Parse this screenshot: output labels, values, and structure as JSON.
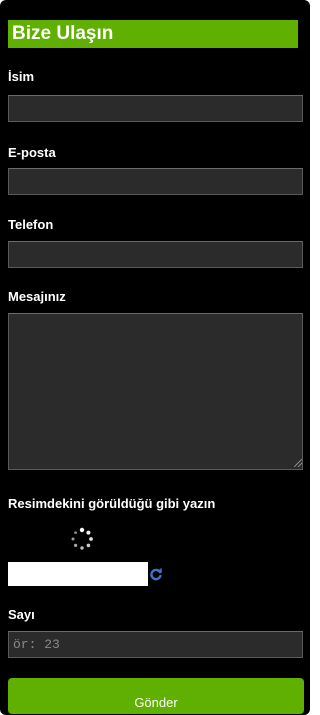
{
  "form": {
    "title": "Bize Ulaşın",
    "fields": {
      "name_label": "İsim",
      "email_label": "E-posta",
      "phone_label": "Telefon",
      "message_label": "Mesajınız"
    },
    "captcha": {
      "instruction": "Resimdekini görüldüğü gibi yazın",
      "image_icon": "loading-spinner-icon",
      "refresh_icon": "refresh-icon"
    },
    "number": {
      "label": "Sayı",
      "placeholder": "ör: 23"
    },
    "submit_label": "Gönder"
  },
  "colors": {
    "panel_bg": "#000000",
    "accent_green": "#5fb000",
    "field_bg": "#2b2b2b",
    "refresh_blue": "#3b74c9"
  }
}
